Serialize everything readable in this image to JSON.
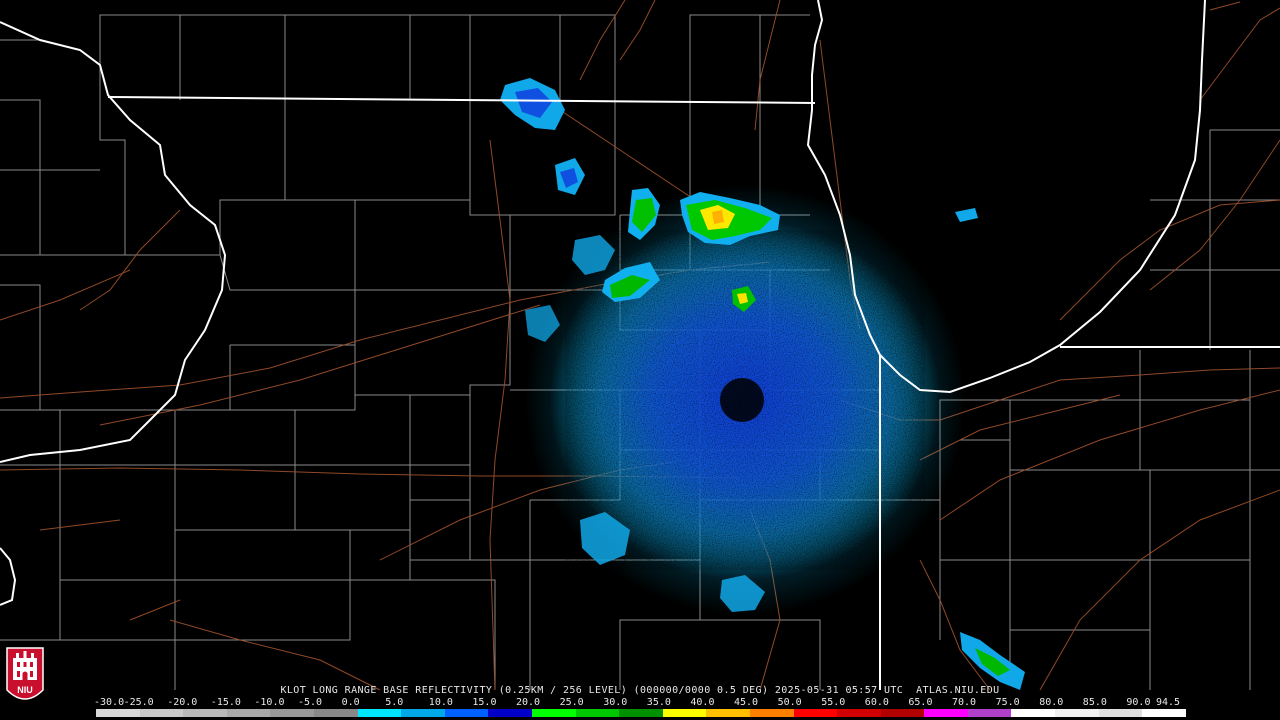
{
  "radar": {
    "title": "KLOT LONG RANGE BASE REFLECTIVITY (0.25KM / 256 LEVEL) (000000/0000 0.5 DEG) 2025-05-31 05:57 UTC  ATLAS.NIU.EDU",
    "station": "KLOT",
    "product": "LONG RANGE BASE REFLECTIVITY",
    "resolution": "0.25KM / 256 LEVEL",
    "elevation": "0.5 DEG",
    "datetime": "2025-05-31 05:57 UTC",
    "source": "ATLAS.NIU.EDU"
  },
  "logo": {
    "text": "NIU",
    "colors": {
      "background": "#c8102e",
      "foreground": "#ffffff"
    }
  },
  "colors": {
    "background": "#000000",
    "state_border": "#ffffff",
    "county_border": "#8a8a8a",
    "road": "#a0522d"
  },
  "scale": {
    "labels": [
      "-30.0",
      "-25.0",
      "-20.0",
      "-15.0",
      "-10.0",
      "-5.0",
      "0.0",
      "5.0",
      "10.0",
      "15.0",
      "20.0",
      "25.0",
      "30.0",
      "35.0",
      "40.0",
      "45.0",
      "50.0",
      "55.0",
      "60.0",
      "65.0",
      "70.0",
      "75.0",
      "80.0",
      "85.0",
      "90.0",
      "94.5"
    ],
    "colors": [
      "#d8d8d8",
      "#c8c8c8",
      "#b8b8b8",
      "#a8a8a8",
      "#989898",
      "#888888",
      "#00e5ff",
      "#00a8e8",
      "#0060ff",
      "#0000c8",
      "#00ff00",
      "#00c800",
      "#009000",
      "#ffff00",
      "#ffc000",
      "#ff8000",
      "#ff0000",
      "#d00000",
      "#b00000",
      "#ff00ff",
      "#b040c8",
      "#ffffff",
      "#f0f0f0",
      "#e0e0e0",
      "#ffffff"
    ]
  }
}
